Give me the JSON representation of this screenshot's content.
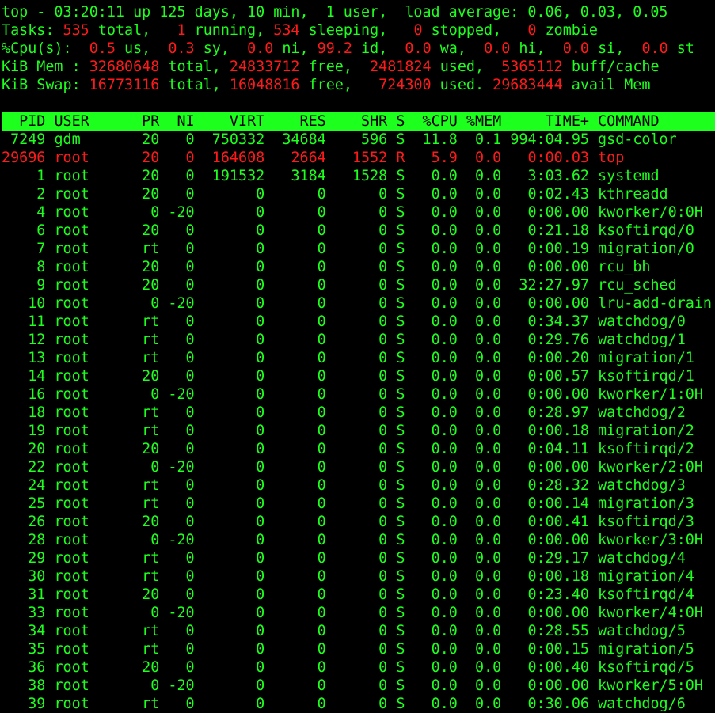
{
  "colors": {
    "fg": "#1dff1d",
    "accent": "#ff1a1a",
    "bg": "#000000"
  },
  "summary": {
    "line1": "top - 03:20:11 up 125 days, 10 min,  1 user,  load average: 0.06, 0.03, 0.05",
    "tasks": {
      "label": "Tasks:",
      "total": "535",
      "total_label": "total,",
      "running": "1",
      "running_label": "running,",
      "sleeping": "534",
      "sleeping_label": "sleeping,",
      "stopped": "0",
      "stopped_label": "stopped,",
      "zombie": "0",
      "zombie_label": "zombie"
    },
    "cpu": {
      "label": "%Cpu(s):",
      "us": "0.5",
      "us_label": "us,",
      "sy": "0.3",
      "sy_label": "sy,",
      "ni": "0.0",
      "ni_label": "ni,",
      "id": "99.2",
      "id_label": "id,",
      "wa": "0.0",
      "wa_label": "wa,",
      "hi": "0.0",
      "hi_label": "hi,",
      "si": "0.0",
      "si_label": "si,",
      "st": "0.0",
      "st_label": "st"
    },
    "mem": {
      "label": "KiB Mem :",
      "total": "32680648",
      "total_label": "total,",
      "free": "24833712",
      "free_label": "free,",
      "used": "2481824",
      "used_label": "used,",
      "buff": "5365112",
      "buff_label": "buff/cache"
    },
    "swap": {
      "label": "KiB Swap:",
      "total": "16773116",
      "total_label": "total,",
      "free": "16048816",
      "free_label": "free,",
      "used": "724300",
      "used_label": "used.",
      "avail": "29683444",
      "avail_label": "avail Mem"
    }
  },
  "columns": [
    "PID",
    "USER",
    "PR",
    "NI",
    "VIRT",
    "RES",
    "SHR",
    "S",
    "%CPU",
    "%MEM",
    "TIME+",
    "COMMAND"
  ],
  "processes": [
    {
      "pid": "7249",
      "user": "gdm",
      "pr": "20",
      "ni": "0",
      "virt": "750332",
      "res": "34684",
      "shr": "596",
      "s": "S",
      "cpu": "11.8",
      "mem": "0.1",
      "time": "994:04.95",
      "cmd": "gsd-color"
    },
    {
      "pid": "29696",
      "user": "root",
      "pr": "20",
      "ni": "0",
      "virt": "164608",
      "res": "2664",
      "shr": "1552",
      "s": "R",
      "cpu": "5.9",
      "mem": "0.0",
      "time": "0:00.03",
      "cmd": "top",
      "highlight": true
    },
    {
      "pid": "1",
      "user": "root",
      "pr": "20",
      "ni": "0",
      "virt": "191532",
      "res": "3184",
      "shr": "1528",
      "s": "S",
      "cpu": "0.0",
      "mem": "0.0",
      "time": "3:03.62",
      "cmd": "systemd"
    },
    {
      "pid": "2",
      "user": "root",
      "pr": "20",
      "ni": "0",
      "virt": "0",
      "res": "0",
      "shr": "0",
      "s": "S",
      "cpu": "0.0",
      "mem": "0.0",
      "time": "0:02.43",
      "cmd": "kthreadd"
    },
    {
      "pid": "4",
      "user": "root",
      "pr": "0",
      "ni": "-20",
      "virt": "0",
      "res": "0",
      "shr": "0",
      "s": "S",
      "cpu": "0.0",
      "mem": "0.0",
      "time": "0:00.00",
      "cmd": "kworker/0:0H"
    },
    {
      "pid": "6",
      "user": "root",
      "pr": "20",
      "ni": "0",
      "virt": "0",
      "res": "0",
      "shr": "0",
      "s": "S",
      "cpu": "0.0",
      "mem": "0.0",
      "time": "0:21.18",
      "cmd": "ksoftirqd/0"
    },
    {
      "pid": "7",
      "user": "root",
      "pr": "rt",
      "ni": "0",
      "virt": "0",
      "res": "0",
      "shr": "0",
      "s": "S",
      "cpu": "0.0",
      "mem": "0.0",
      "time": "0:00.19",
      "cmd": "migration/0"
    },
    {
      "pid": "8",
      "user": "root",
      "pr": "20",
      "ni": "0",
      "virt": "0",
      "res": "0",
      "shr": "0",
      "s": "S",
      "cpu": "0.0",
      "mem": "0.0",
      "time": "0:00.00",
      "cmd": "rcu_bh"
    },
    {
      "pid": "9",
      "user": "root",
      "pr": "20",
      "ni": "0",
      "virt": "0",
      "res": "0",
      "shr": "0",
      "s": "S",
      "cpu": "0.0",
      "mem": "0.0",
      "time": "32:27.97",
      "cmd": "rcu_sched"
    },
    {
      "pid": "10",
      "user": "root",
      "pr": "0",
      "ni": "-20",
      "virt": "0",
      "res": "0",
      "shr": "0",
      "s": "S",
      "cpu": "0.0",
      "mem": "0.0",
      "time": "0:00.00",
      "cmd": "lru-add-drain"
    },
    {
      "pid": "11",
      "user": "root",
      "pr": "rt",
      "ni": "0",
      "virt": "0",
      "res": "0",
      "shr": "0",
      "s": "S",
      "cpu": "0.0",
      "mem": "0.0",
      "time": "0:34.37",
      "cmd": "watchdog/0"
    },
    {
      "pid": "12",
      "user": "root",
      "pr": "rt",
      "ni": "0",
      "virt": "0",
      "res": "0",
      "shr": "0",
      "s": "S",
      "cpu": "0.0",
      "mem": "0.0",
      "time": "0:29.76",
      "cmd": "watchdog/1"
    },
    {
      "pid": "13",
      "user": "root",
      "pr": "rt",
      "ni": "0",
      "virt": "0",
      "res": "0",
      "shr": "0",
      "s": "S",
      "cpu": "0.0",
      "mem": "0.0",
      "time": "0:00.20",
      "cmd": "migration/1"
    },
    {
      "pid": "14",
      "user": "root",
      "pr": "20",
      "ni": "0",
      "virt": "0",
      "res": "0",
      "shr": "0",
      "s": "S",
      "cpu": "0.0",
      "mem": "0.0",
      "time": "0:00.57",
      "cmd": "ksoftirqd/1"
    },
    {
      "pid": "16",
      "user": "root",
      "pr": "0",
      "ni": "-20",
      "virt": "0",
      "res": "0",
      "shr": "0",
      "s": "S",
      "cpu": "0.0",
      "mem": "0.0",
      "time": "0:00.00",
      "cmd": "kworker/1:0H"
    },
    {
      "pid": "18",
      "user": "root",
      "pr": "rt",
      "ni": "0",
      "virt": "0",
      "res": "0",
      "shr": "0",
      "s": "S",
      "cpu": "0.0",
      "mem": "0.0",
      "time": "0:28.97",
      "cmd": "watchdog/2"
    },
    {
      "pid": "19",
      "user": "root",
      "pr": "rt",
      "ni": "0",
      "virt": "0",
      "res": "0",
      "shr": "0",
      "s": "S",
      "cpu": "0.0",
      "mem": "0.0",
      "time": "0:00.18",
      "cmd": "migration/2"
    },
    {
      "pid": "20",
      "user": "root",
      "pr": "20",
      "ni": "0",
      "virt": "0",
      "res": "0",
      "shr": "0",
      "s": "S",
      "cpu": "0.0",
      "mem": "0.0",
      "time": "0:04.11",
      "cmd": "ksoftirqd/2"
    },
    {
      "pid": "22",
      "user": "root",
      "pr": "0",
      "ni": "-20",
      "virt": "0",
      "res": "0",
      "shr": "0",
      "s": "S",
      "cpu": "0.0",
      "mem": "0.0",
      "time": "0:00.00",
      "cmd": "kworker/2:0H"
    },
    {
      "pid": "24",
      "user": "root",
      "pr": "rt",
      "ni": "0",
      "virt": "0",
      "res": "0",
      "shr": "0",
      "s": "S",
      "cpu": "0.0",
      "mem": "0.0",
      "time": "0:28.32",
      "cmd": "watchdog/3"
    },
    {
      "pid": "25",
      "user": "root",
      "pr": "rt",
      "ni": "0",
      "virt": "0",
      "res": "0",
      "shr": "0",
      "s": "S",
      "cpu": "0.0",
      "mem": "0.0",
      "time": "0:00.14",
      "cmd": "migration/3"
    },
    {
      "pid": "26",
      "user": "root",
      "pr": "20",
      "ni": "0",
      "virt": "0",
      "res": "0",
      "shr": "0",
      "s": "S",
      "cpu": "0.0",
      "mem": "0.0",
      "time": "0:00.41",
      "cmd": "ksoftirqd/3"
    },
    {
      "pid": "28",
      "user": "root",
      "pr": "0",
      "ni": "-20",
      "virt": "0",
      "res": "0",
      "shr": "0",
      "s": "S",
      "cpu": "0.0",
      "mem": "0.0",
      "time": "0:00.00",
      "cmd": "kworker/3:0H"
    },
    {
      "pid": "29",
      "user": "root",
      "pr": "rt",
      "ni": "0",
      "virt": "0",
      "res": "0",
      "shr": "0",
      "s": "S",
      "cpu": "0.0",
      "mem": "0.0",
      "time": "0:29.17",
      "cmd": "watchdog/4"
    },
    {
      "pid": "30",
      "user": "root",
      "pr": "rt",
      "ni": "0",
      "virt": "0",
      "res": "0",
      "shr": "0",
      "s": "S",
      "cpu": "0.0",
      "mem": "0.0",
      "time": "0:00.18",
      "cmd": "migration/4"
    },
    {
      "pid": "31",
      "user": "root",
      "pr": "20",
      "ni": "0",
      "virt": "0",
      "res": "0",
      "shr": "0",
      "s": "S",
      "cpu": "0.0",
      "mem": "0.0",
      "time": "0:23.40",
      "cmd": "ksoftirqd/4"
    },
    {
      "pid": "33",
      "user": "root",
      "pr": "0",
      "ni": "-20",
      "virt": "0",
      "res": "0",
      "shr": "0",
      "s": "S",
      "cpu": "0.0",
      "mem": "0.0",
      "time": "0:00.00",
      "cmd": "kworker/4:0H"
    },
    {
      "pid": "34",
      "user": "root",
      "pr": "rt",
      "ni": "0",
      "virt": "0",
      "res": "0",
      "shr": "0",
      "s": "S",
      "cpu": "0.0",
      "mem": "0.0",
      "time": "0:28.55",
      "cmd": "watchdog/5"
    },
    {
      "pid": "35",
      "user": "root",
      "pr": "rt",
      "ni": "0",
      "virt": "0",
      "res": "0",
      "shr": "0",
      "s": "S",
      "cpu": "0.0",
      "mem": "0.0",
      "time": "0:00.15",
      "cmd": "migration/5"
    },
    {
      "pid": "36",
      "user": "root",
      "pr": "20",
      "ni": "0",
      "virt": "0",
      "res": "0",
      "shr": "0",
      "s": "S",
      "cpu": "0.0",
      "mem": "0.0",
      "time": "0:00.40",
      "cmd": "ksoftirqd/5"
    },
    {
      "pid": "38",
      "user": "root",
      "pr": "0",
      "ni": "-20",
      "virt": "0",
      "res": "0",
      "shr": "0",
      "s": "S",
      "cpu": "0.0",
      "mem": "0.0",
      "time": "0:00.00",
      "cmd": "kworker/5:0H"
    },
    {
      "pid": "39",
      "user": "root",
      "pr": "rt",
      "ni": "0",
      "virt": "0",
      "res": "0",
      "shr": "0",
      "s": "S",
      "cpu": "0.0",
      "mem": "0.0",
      "time": "0:30.06",
      "cmd": "watchdog/6"
    }
  ]
}
